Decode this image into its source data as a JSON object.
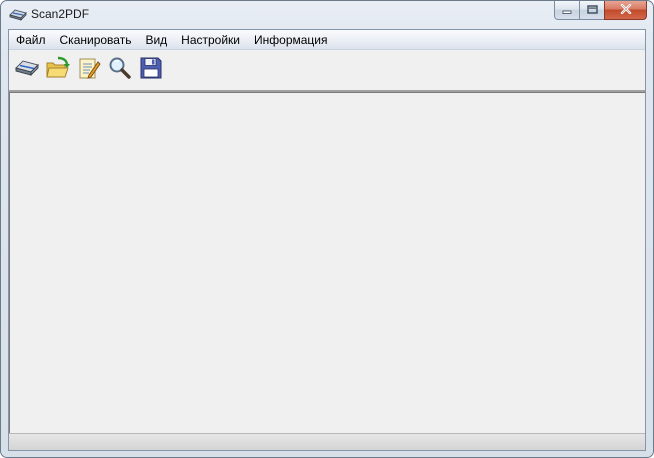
{
  "window": {
    "title": "Scan2PDF",
    "icon": "scanner-icon"
  },
  "caption_buttons": {
    "minimize": "minimize-icon",
    "maximize": "maximize-icon",
    "close": "close-icon"
  },
  "menu": {
    "items": [
      {
        "label": "Файл"
      },
      {
        "label": "Сканировать"
      },
      {
        "label": "Вид"
      },
      {
        "label": "Настройки"
      },
      {
        "label": "Информация"
      }
    ]
  },
  "toolbar": {
    "buttons": [
      {
        "icon": "scanner-icon"
      },
      {
        "icon": "open-folder-icon"
      },
      {
        "icon": "edit-document-icon"
      },
      {
        "icon": "magnifier-icon"
      },
      {
        "icon": "floppy-save-icon"
      }
    ]
  },
  "statusbar": {
    "text": ""
  }
}
